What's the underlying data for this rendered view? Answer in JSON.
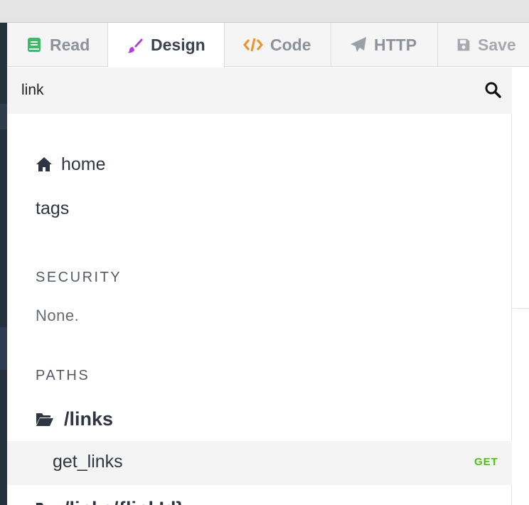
{
  "tabs": {
    "read": {
      "label": "Read",
      "icon": "book-icon",
      "color": "#3fb867"
    },
    "design": {
      "label": "Design",
      "icon": "paintbrush-icon",
      "color": "#b13ed8"
    },
    "code": {
      "label": "Code",
      "icon": "code-icon",
      "color": "#f0912a"
    },
    "http": {
      "label": "HTTP",
      "icon": "paper-plane-icon"
    },
    "save": {
      "label": "Save",
      "icon": "floppy-disk-icon"
    }
  },
  "search": {
    "value": "link",
    "icon": "search-icon"
  },
  "nav": {
    "home_label": "home",
    "home_icon": "home-icon",
    "tags_label": "tags"
  },
  "security": {
    "heading": "SECURITY",
    "value": "None."
  },
  "paths": {
    "heading": "PATHS",
    "items": [
      {
        "path": "/links",
        "icon": "folder-open-icon",
        "operations": [
          {
            "name": "get_links",
            "method": "GET",
            "method_color": "#4fbf1b"
          }
        ]
      },
      {
        "path": "/links/{linkId}",
        "icon": "folder-open-icon"
      }
    ]
  }
}
